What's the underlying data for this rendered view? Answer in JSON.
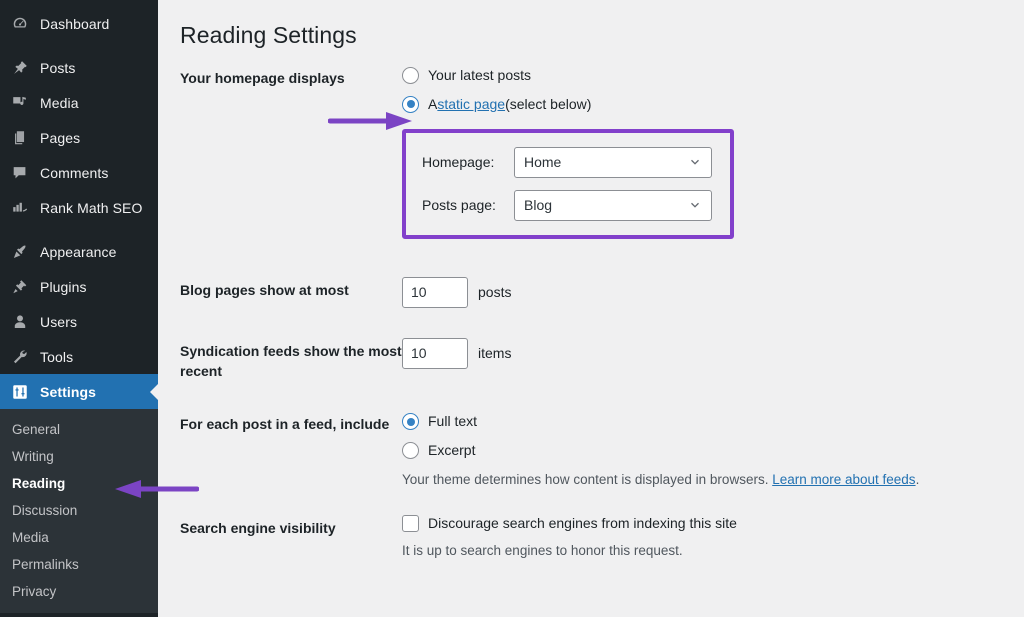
{
  "sidebar": {
    "items": [
      {
        "label": "Dashboard",
        "icon": "dashboard-icon",
        "active": false
      },
      {
        "label": "Posts",
        "icon": "pin-icon",
        "active": false
      },
      {
        "label": "Media",
        "icon": "media-icon",
        "active": false
      },
      {
        "label": "Pages",
        "icon": "pages-icon",
        "active": false
      },
      {
        "label": "Comments",
        "icon": "comments-icon",
        "active": false
      },
      {
        "label": "Rank Math SEO",
        "icon": "rank-math-icon",
        "active": false
      },
      {
        "label": "Appearance",
        "icon": "appearance-icon",
        "active": false
      },
      {
        "label": "Plugins",
        "icon": "plugins-icon",
        "active": false
      },
      {
        "label": "Users",
        "icon": "users-icon",
        "active": false
      },
      {
        "label": "Tools",
        "icon": "tools-icon",
        "active": false
      },
      {
        "label": "Settings",
        "icon": "settings-icon",
        "active": true
      }
    ],
    "submenu": [
      {
        "label": "General",
        "current": false
      },
      {
        "label": "Writing",
        "current": false
      },
      {
        "label": "Reading",
        "current": true
      },
      {
        "label": "Discussion",
        "current": false
      },
      {
        "label": "Media",
        "current": false
      },
      {
        "label": "Permalinks",
        "current": false
      },
      {
        "label": "Privacy",
        "current": false
      }
    ]
  },
  "main": {
    "page_title": "Reading Settings",
    "homepage_displays": {
      "label": "Your homepage displays",
      "option_latest_posts": "Your latest posts",
      "option_static_prefix": "A ",
      "option_static_link": "static page",
      "option_static_suffix": " (select below)",
      "selected": "static_page",
      "homepage_label": "Homepage:",
      "homepage_value": "Home",
      "posts_page_label": "Posts page:",
      "posts_page_value": "Blog"
    },
    "blog_pages": {
      "label": "Blog pages show at most",
      "value": "10",
      "suffix": "posts"
    },
    "syndication": {
      "label": "Syndication feeds show the most recent",
      "value": "10",
      "suffix": "items"
    },
    "feed_include": {
      "label": "For each post in a feed, include",
      "option_full_text": "Full text",
      "option_excerpt": "Excerpt",
      "selected": "full_text",
      "help_prefix": "Your theme determines how content is displayed in browsers. ",
      "help_link": "Learn more about feeds",
      "help_suffix": "."
    },
    "search_visibility": {
      "label": "Search engine visibility",
      "checkbox_label": "Discourage search engines from indexing this site",
      "checked": false,
      "help": "It is up to search engines to honor this request."
    }
  },
  "annotations": {
    "arrow_color": "#7b44c4",
    "highlight_box_color": "#8240cb",
    "arrow_static_page_target": "static-page-radio",
    "arrow_reading_target": "sidebar-submenu-reading"
  },
  "colors": {
    "sidebar_bg": "#1d2327",
    "submenu_bg": "#2c3338",
    "accent_blue": "#2271b1",
    "page_bg": "#f0f0f1",
    "link": "#2271b1"
  }
}
